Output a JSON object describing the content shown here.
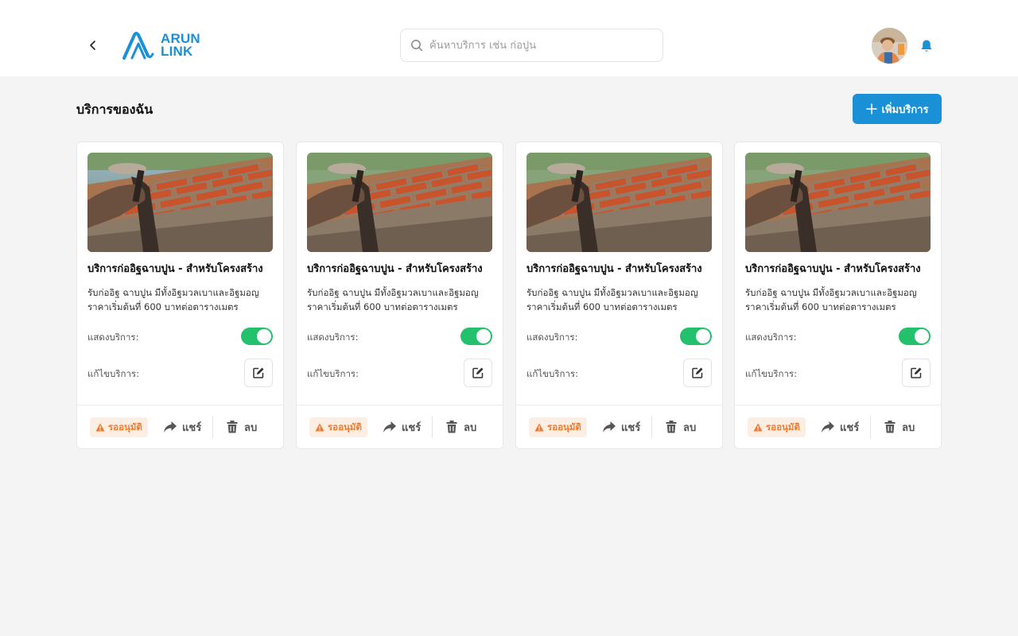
{
  "header": {
    "logo_line1": "ARUN",
    "logo_line2": "LINK",
    "search_placeholder": "ค้นหาบริการ เช่น ก่อปูน",
    "back_icon": "chevron-left-icon",
    "search_icon": "search-icon",
    "bell_icon": "bell-icon",
    "accent_color": "#1a91d6"
  },
  "page": {
    "title": "บริการของฉัน",
    "add_button_label": "เพิ่มบริการ"
  },
  "cards": [
    {
      "title": "บริการก่ออิฐฉาบปูน - สำหรับโครงสร้าง",
      "desc_line1": "รับก่ออิฐ ฉาบปูน มีทั้งอิฐมวลเบาและอิฐมอญ",
      "desc_line2": "ราคาเริ่มต้นที่ 600 บาทต่อตารางเมตร",
      "show_label": "แสดงบริการ:",
      "show_enabled": true,
      "edit_label": "แก้ไขบริการ:",
      "status": "รออนุมัติ",
      "share_label": "แชร์",
      "delete_label": "ลบ"
    },
    {
      "title": "บริการก่ออิฐฉาบปูน - สำหรับโครงสร้าง",
      "desc_line1": "รับก่ออิฐ ฉาบปูน มีทั้งอิฐมวลเบาและอิฐมอญ",
      "desc_line2": "ราคาเริ่มต้นที่ 600 บาทต่อตารางเมตร",
      "show_label": "แสดงบริการ:",
      "show_enabled": true,
      "edit_label": "แก้ไขบริการ:",
      "status": "รออนุมัติ",
      "share_label": "แชร์",
      "delete_label": "ลบ"
    },
    {
      "title": "บริการก่ออิฐฉาบปูน - สำหรับโครงสร้าง",
      "desc_line1": "รับก่ออิฐ ฉาบปูน มีทั้งอิฐมวลเบาและอิฐมอญ",
      "desc_line2": "ราคาเริ่มต้นที่ 600 บาทต่อตารางเมตร",
      "show_label": "แสดงบริการ:",
      "show_enabled": true,
      "edit_label": "แก้ไขบริการ:",
      "status": "รออนุมัติ",
      "share_label": "แชร์",
      "delete_label": "ลบ"
    },
    {
      "title": "บริการก่ออิฐฉาบปูน - สำหรับโครงสร้าง",
      "desc_line1": "รับก่ออิฐ ฉาบปูน มีทั้งอิฐมวลเบาและอิฐมอญ",
      "desc_line2": "ราคาเริ่มต้นที่ 600 บาทต่อตารางเมตร",
      "show_label": "แสดงบริการ:",
      "show_enabled": true,
      "edit_label": "แก้ไขบริการ:",
      "status": "รออนุมัติ",
      "share_label": "แชร์",
      "delete_label": "ลบ"
    }
  ],
  "colors": {
    "toggle_on": "#23c16b",
    "status_pending_text": "#f07a2c",
    "status_pending_bg": "#fdeee4"
  }
}
